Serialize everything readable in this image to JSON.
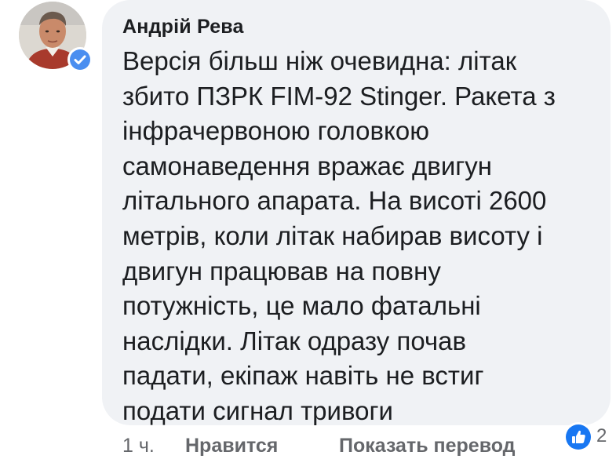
{
  "comment": {
    "author": "Андрій Рева",
    "text_lines": [
      "Версія більш ніж очевидна: літак",
      "збито ПЗРК FIM-92 Stinger. Ракета з",
      "інфрачервоною головкою",
      "самонаведення вражає двигун",
      "літального апарата. На висоті 2600",
      "метрів, коли літак набирав висоту і",
      "двигун працював на повну",
      "потужність, це мало фатальні",
      "наслідки. Літак одразу почав",
      "падати, екіпаж навіть не встиг",
      "подати сигнал тривоги"
    ]
  },
  "actions": {
    "time": "1 ч.",
    "like_label": "Нравится",
    "translate_label": "Показать перевод"
  },
  "reactions": {
    "icon": "like-thumb-icon",
    "count": "2"
  },
  "colors": {
    "bubble_bg": "#f0f2f5",
    "text": "#1c1e21",
    "secondary_text": "#65676b",
    "verified_badge": "#4a8ef0",
    "like_blue": "#1877f2"
  }
}
